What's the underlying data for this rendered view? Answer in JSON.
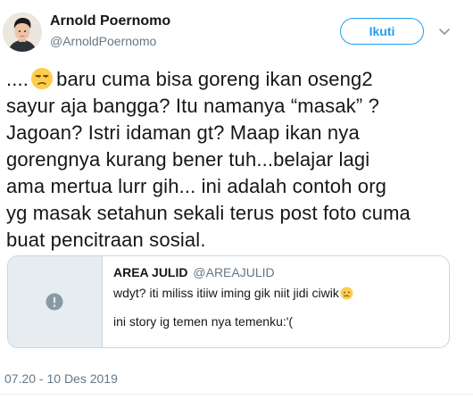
{
  "author": {
    "display_name": "Arnold Poernomo",
    "handle": "@ArnoldPoernomo",
    "avatar_icon": "profile-photo"
  },
  "follow_button": {
    "label": "Ikuti"
  },
  "menu": {
    "icon": "chevron-down-icon"
  },
  "tweet": {
    "line1_before_emoji": "....",
    "emoji": "unamused-face",
    "line1_after_emoji": "baru cuma bisa goreng ikan oseng2",
    "lines": [
      "sayur aja bangga? Itu namanya “masak” ?",
      "Jagoan? Istri idaman gt? Maap ikan nya",
      "gorengnya kurang bener tuh...belajar lagi",
      "ama mertua lurr gih... ini adalah contoh org",
      "yg masak setahun sekali terus post foto cuma",
      "buat pencitraan sosial."
    ]
  },
  "quoted_tweet": {
    "name": "AREA JULID",
    "handle": "@AREAJULID",
    "text_line1": "wdyt? iti miliss itiiw iming gik niit jidi ciwik",
    "text_line1_emoji": "crying-face",
    "text_line2": "ini story ig temen nya temenku:'(",
    "media_icon": "media-unavailable-icon"
  },
  "timestamp": "07.20 - 10 Des 2019",
  "colors": {
    "accent": "#1da1f2",
    "text": "#14171a",
    "secondary": "#657786",
    "border": "#ccd6dd"
  }
}
